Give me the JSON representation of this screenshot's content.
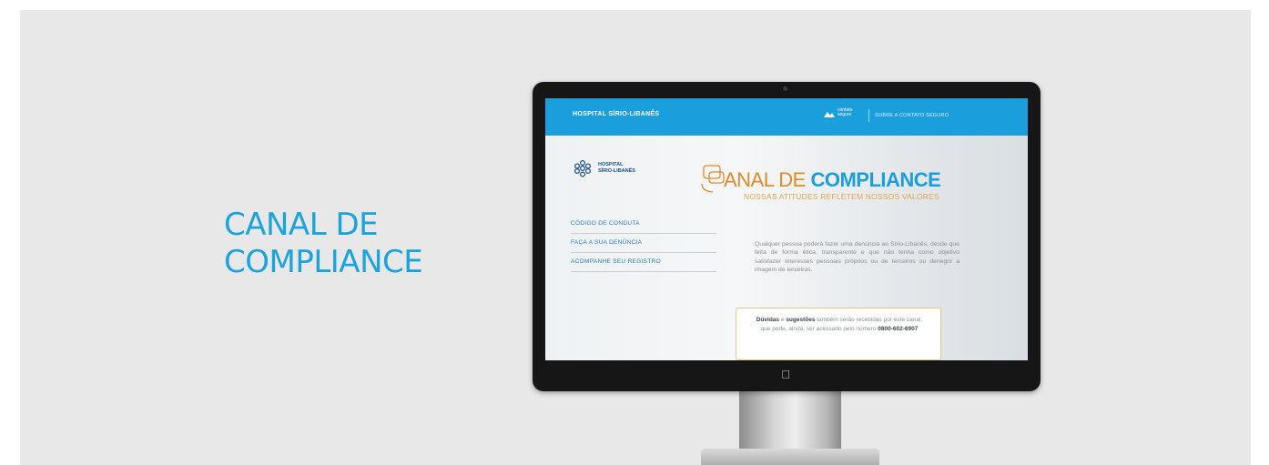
{
  "heading": {
    "line1": "CANAL DE",
    "line2": "COMPLIANCE"
  },
  "colors": {
    "accent": "#1aa3dd",
    "orange": "#e08a2a",
    "background": "#e8e8e8"
  },
  "screen": {
    "topbar": {
      "hospital_name": "HOSPITAL SÍRIO-LIBANÊS",
      "logo_text": "contato seguro",
      "link": "SOBRE A CONTATO SEGURO"
    },
    "logo": {
      "line1": "HOSPITAL",
      "line2": "SÍRIO-LIBANÊS",
      "icon": "hospital-logo-icon"
    },
    "menu": [
      {
        "label": "CÓDIGO DE CONDUTA"
      },
      {
        "label": "FAÇA A SUA DENÚNCIA"
      },
      {
        "label": "ACOMPANHE SEU REGISTRO"
      }
    ],
    "title": {
      "light": "ANAL DE ",
      "bold": "COMPLIANCE",
      "icon": "chat-bubbles-icon"
    },
    "subtitle": "NOSSAS ATITUDES REFLETEM NOSSOS VALORES",
    "body": "Qualquer pessoa poderá fazer uma denúncia ao Sírio-Libanês, desde que feita de forma ética, transparente e que não tenha como objetivo satisfazer interesses pessoais próprios ou de terceiros ou denegrir a imagem de terceiros.",
    "info": {
      "bold1": "Dúvidas",
      "t1": " e ",
      "bold2": "sugestões",
      "t2": " também serão recebidas por este canal, que pode, ainda, ser acessado pelo número ",
      "phone": "0800-602-6907"
    }
  },
  "monitor": {
    "brand_icon": "apple-logo-icon"
  }
}
